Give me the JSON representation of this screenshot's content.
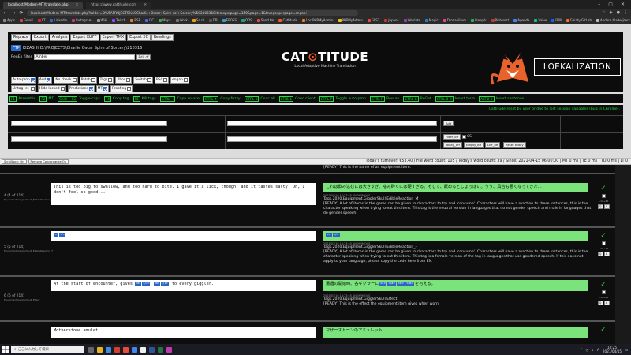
{
  "browser": {
    "tabs": [
      {
        "title": "localhost/Modern-MT/translate.php",
        "active": true
      },
      {
        "title": "https://www.cattitude.com",
        "active": false
      }
    ],
    "url": "localhost/Modern-MT/translate.php?folder=D%5APROJECTS%5CCharlie+Oscar+Spire+of+Sorcery%5C210316&itemsperpage=150&page=1&truegoeperpage=engapi",
    "bookmarks": [
      "Apps",
      "Gmail",
      "YT",
      "Linkedin",
      "Instagram",
      "Wiki",
      "Twitch",
      "RSE",
      "DC",
      "Maps",
      "Work",
      "Sa.nl",
      "DB",
      "EBOSS",
      "ODS",
      "Send.fm",
      "Cattitude",
      "Loc PHPMyAdmin",
      "PHPMyAdmin",
      "GLS2",
      "Japans",
      "Weblate",
      "Magic",
      "Dronabilium",
      "Freepik",
      "Pinterest",
      "Agenda",
      "Valve",
      "IBM",
      "Gaiaty GitLab",
      "Andere bladwijzers"
    ]
  },
  "menu": [
    "Replace",
    "Export",
    "Analysis",
    "Export XLIFF",
    "Export TMX",
    "Export 2C",
    "Readings"
  ],
  "project": {
    "badge": "FTP",
    "user": "KIZASHI",
    "path": "D:\\PROJECTS\\Charlie Oscar Spire of Sorcery\\210316"
  },
  "regex": {
    "label": "RegEx filter",
    "value": "Amber",
    "button": "Edit df"
  },
  "options_row1": [
    {
      "label": "Auto-prop",
      "checked": true
    },
    {
      "label": "Add",
      "checked": true
    },
    {
      "label": "No check",
      "checked": false
    },
    {
      "label": "Patch",
      "checked": false
    },
    {
      "label": "Tags",
      "checked": false
    },
    {
      "label": "Xbox",
      "checked": false
    },
    {
      "label": "Switch",
      "checked": false
    },
    {
      "label": "PS4",
      "checked": false
    },
    {
      "label": "engap",
      "checked": false
    }
  ],
  "options_row2": [
    {
      "label": "Untag <>",
      "checked": false
    },
    {
      "label": "Hide locked",
      "checked": false
    },
    {
      "label": "Predictions",
      "checked": true
    },
    {
      "label": "MT",
      "checked": true
    },
    {
      "label": "Proofing",
      "checked": false
    }
  ],
  "logo": {
    "main_left": "CAT",
    "main_right": "TITUDE",
    "sub": "Local Adaptive Machine Translation"
  },
  "partner_logo": "LOEKALIZATION",
  "shortcuts": [
    {
      "key": "F1",
      "label": "Assemble"
    },
    {
      "key": "F2",
      "label": "MT"
    },
    {
      "key": "Shift + F3",
      "label": "Toggle caps"
    },
    {
      "key": "F4",
      "label": "Copy tag"
    },
    {
      "key": "F6",
      "label": "Kill tags"
    },
    {
      "key": "CTRL →",
      "label": "Copy source"
    },
    {
      "key": "CTRL ↑",
      "label": "Copy fuzzy"
    },
    {
      "key": "CTRL K",
      "label": "Conc all"
    },
    {
      "key": "CTRL L",
      "label": "Conc client"
    },
    {
      "key": "CTRL P",
      "label": "Toggle auto-prop"
    },
    {
      "key": "CTRL R",
      "label": "Rescan"
    },
    {
      "key": "CTRL G",
      "label": "ReGet"
    },
    {
      "key": "CTRL 0-9",
      "label": "Insert term"
    },
    {
      "key": "ALT 0-9",
      "label": "Insert sentence"
    }
  ],
  "filter": {
    "notice": "Cattitude reset by user or due to lost session variables (bug in Chrome).",
    "add_btn": "Add",
    "filter_btn": "Filter_off",
    "cs_label": "CS",
    "buttons": [
      "Today_off",
      "Empty_off",
      "Diff_off",
      "Reset today"
    ]
  },
  "status": {
    "left_buttons": [
      "ScrollLock: On",
      "Remove Concordance On"
    ],
    "turnover": "Today's turnover: €53.40 / File word count: 105 / Today's word count: 39 / Since: 2021-04-15 06:00:00 | MT 0 ms | TE 0 ms | TO 0 ms | LT 0"
  },
  "segments": [
    {
      "info": "",
      "info_small": "",
      "source": "",
      "target": "",
      "meta_id": "",
      "meta_text": "[READY] This is the name of an equipment item."
    },
    {
      "info": "4 (4 of 214)",
      "info_small": "Equipment.GigglerSkull_EdibleReaction_M",
      "source": "This is too big to swallow, and too hard to bite. I gave it a lick, though, and it tastes salty. Oh, I don't feel so good...",
      "target": "これは飲み込むには大きすぎ、噛み砕くには硬すぎる。そして、舐めるとしょっぱい。うう、具合も悪くなってきた…",
      "meta_ts": "2021/03/16 14:23:55 ANONYMOUS",
      "meta_id": "Tags.2020.Equipment.GigglerSkull.EdibleReaction_M",
      "meta_text": "[READY] A lot of items in the game can be given to characters to try and 'consume'. Characters will have a reaction to these instances, this is the character speaking when trying to eat this item. This tag is the neutral version in languages that do not gender speech and male in languages that do gender speech.",
      "count": "+10+40"
    },
    {
      "info": "5 (5 of 214)",
      "info_small": "Equipment.GigglerSkull_EdibleReaction_F",
      "source_tags": [
        "<>",
        "</>"
      ],
      "target_tags": [
        "<>",
        "</>"
      ],
      "meta_ts": "2021/03/16 14:23:55 ANONYMOUS",
      "meta_id": "Tags.2020.Equipment.GigglerSkull.EdibleReaction_F",
      "meta_text": "[READY] A lot of items in the game can be given to characters to try and 'consume'. Characters will have a reaction to these instances, this is the character speaking when trying to eat this item. This tag is a female version of the tag in languages that use gendered speech. If this does not apply to your language, please copy the code here from EN.",
      "count": "+10+10"
    },
    {
      "info": "6 (6 of 214)",
      "info_small": "Equipment.GigglerSkull_Effect",
      "source": "At the start of encounter, gives",
      "source_after": "to every giggler.",
      "target": "遭遇の開始時、各ギグラーに",
      "target_after": "を与える。",
      "meta_ts": "2021/03/16 14:23:55 ANONYMOUS",
      "meta_id": "Tags.2020.Equipment.GigglerSkull.Effect",
      "meta_text": "[READY] This is the effect the equipment item gives when worn.",
      "count": "+10+45"
    },
    {
      "info": "",
      "info_small": "",
      "source": "Motherstone amulet",
      "target": "マザーストーンのアミュレット",
      "meta_id": "",
      "meta_text": ""
    }
  ],
  "taskbar": {
    "search_placeholder": "ここに入力して検索",
    "time": "10:25",
    "date": "2021/04/15",
    "lang": "A"
  }
}
